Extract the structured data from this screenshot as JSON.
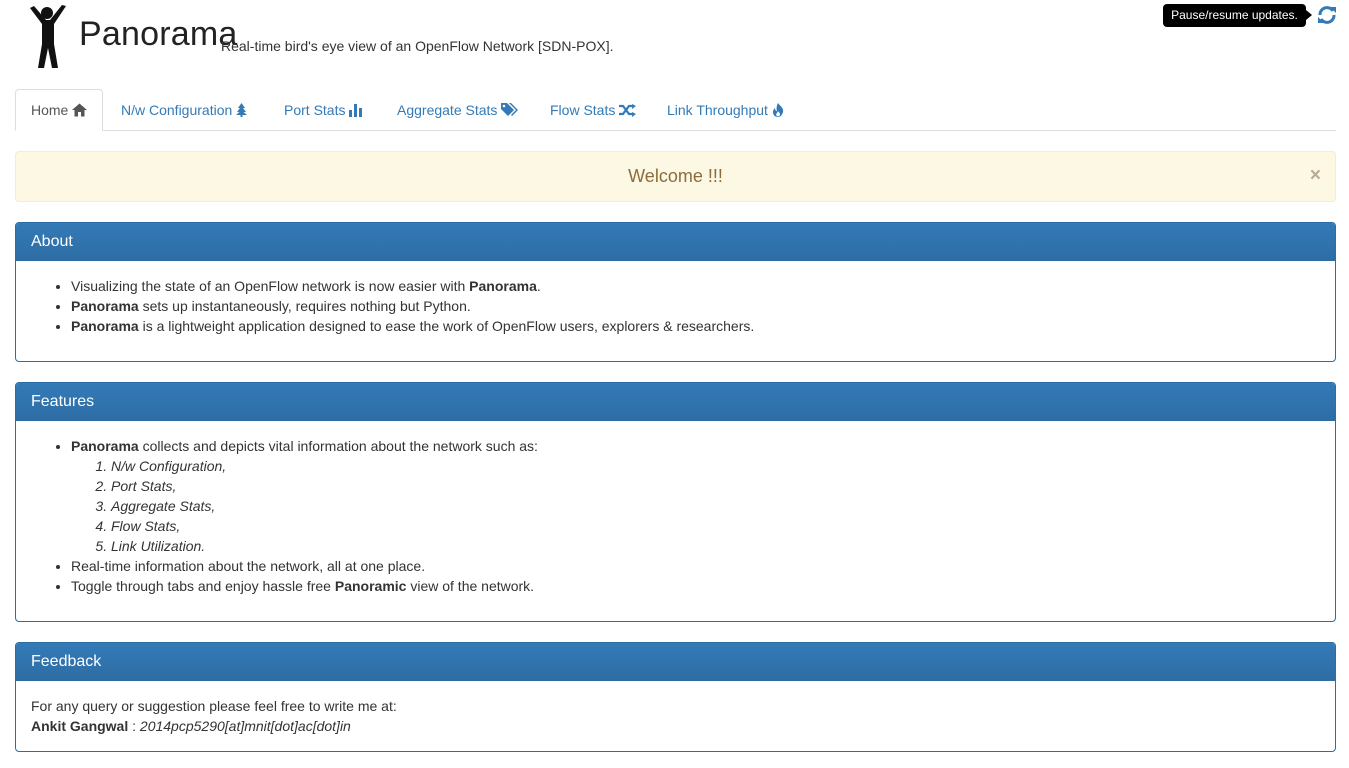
{
  "header": {
    "title": "Panorama",
    "subtitle": "Real-time bird's eye view of an OpenFlow Network [SDN-POX].",
    "tooltip": "Pause/resume updates."
  },
  "tabs": [
    {
      "label": "Home",
      "icon": "home-icon"
    },
    {
      "label": "N/w Configuration",
      "icon": "tree-icon"
    },
    {
      "label": "Port Stats",
      "icon": "bar-chart-icon"
    },
    {
      "label": "Aggregate Stats",
      "icon": "tags-icon"
    },
    {
      "label": "Flow Stats",
      "icon": "shuffle-icon"
    },
    {
      "label": "Link Throughput",
      "icon": "fire-icon"
    }
  ],
  "alert": {
    "text": "Welcome !!!",
    "close": "×"
  },
  "about": {
    "heading": "About",
    "items": [
      {
        "pre": "Visualizing the state of an OpenFlow network is now easier with ",
        "bold": "Panorama",
        "post": "."
      },
      {
        "pre": "",
        "bold": "Panorama",
        "post": " sets up instantaneously, requires nothing but Python."
      },
      {
        "pre": "",
        "bold": "Panorama",
        "post": " is a lightweight application designed to ease the work of OpenFlow users, explorers & researchers."
      }
    ]
  },
  "features": {
    "heading": "Features",
    "intro_bold": "Panorama",
    "intro_rest": " collects and depicts vital information about the network such as:",
    "list": [
      "N/w Configuration,",
      "Port Stats,",
      "Aggregate Stats,",
      "Flow Stats,",
      "Link Utilization."
    ],
    "item2": "Real-time information about the network, all at one place.",
    "item3_pre": "Toggle through tabs and enjoy hassle free ",
    "item3_bold": "Panoramic",
    "item3_post": " view of the network."
  },
  "feedback": {
    "heading": "Feedback",
    "line1": "For any query or suggestion please feel free to write me at:",
    "name": "Ankit Gangwal",
    "separator": " : ",
    "email": "2014pcp5290[at]mnit[dot]ac[dot]in"
  },
  "colors": {
    "link": "#337ab7",
    "panel_primary": "#337ab7",
    "alert_bg": "#fcf8e3",
    "alert_text": "#8a6d3b"
  }
}
